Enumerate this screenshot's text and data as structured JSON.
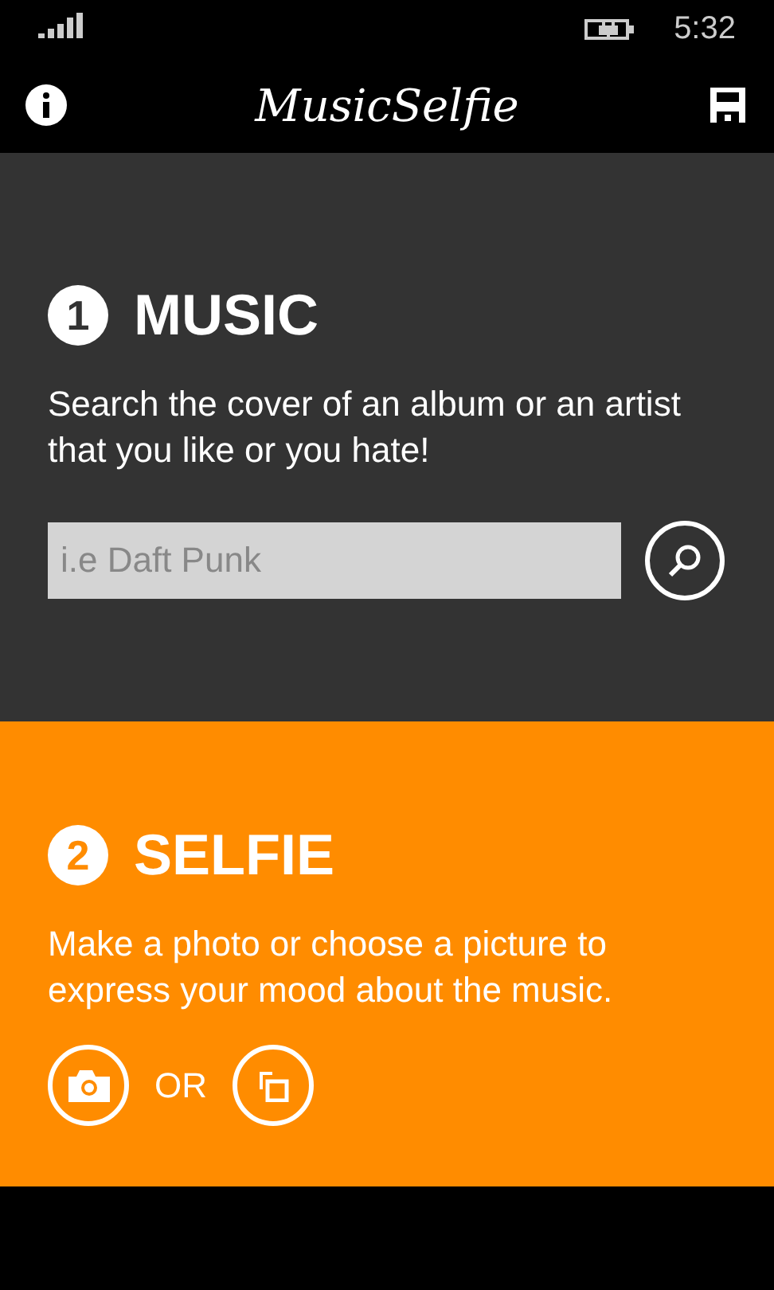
{
  "status_bar": {
    "time": "5:32"
  },
  "header": {
    "logo": "MusicSelfie"
  },
  "sections": [
    {
      "kind": "music",
      "number": "1",
      "title": "MUSIC",
      "description": "Search the cover of an album or an artist that you like or you hate!",
      "search": {
        "placeholder": "i.e Daft Punk"
      }
    },
    {
      "kind": "selfie",
      "number": "2",
      "title": "SELFIE",
      "description": "Make a photo or choose a picture to express your mood about the music.",
      "separator": "OR"
    }
  ]
}
